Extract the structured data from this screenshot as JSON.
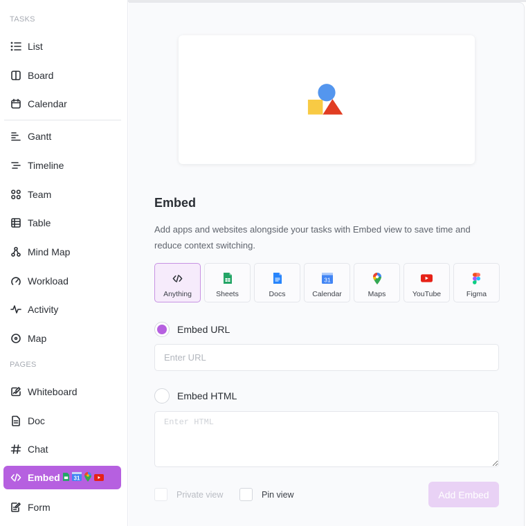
{
  "sidebar": {
    "sections": {
      "tasks": "TASKS",
      "pages": "PAGES"
    },
    "task_items": [
      {
        "label": "List",
        "icon": "list-icon"
      },
      {
        "label": "Board",
        "icon": "board-icon"
      },
      {
        "label": "Calendar",
        "icon": "calendar-icon"
      },
      {
        "label": "Gantt",
        "icon": "gantt-icon"
      },
      {
        "label": "Timeline",
        "icon": "timeline-icon"
      },
      {
        "label": "Team",
        "icon": "team-icon"
      },
      {
        "label": "Table",
        "icon": "table-icon"
      },
      {
        "label": "Mind Map",
        "icon": "mind-map-icon"
      },
      {
        "label": "Workload",
        "icon": "workload-icon"
      },
      {
        "label": "Activity",
        "icon": "activity-icon"
      },
      {
        "label": "Map",
        "icon": "map-pin-icon"
      }
    ],
    "page_items": [
      {
        "label": "Whiteboard",
        "icon": "whiteboard-icon"
      },
      {
        "label": "Doc",
        "icon": "doc-icon"
      },
      {
        "label": "Chat",
        "icon": "hash-icon"
      },
      {
        "label": "Embed",
        "icon": "code-icon",
        "active": true
      },
      {
        "label": "Form",
        "icon": "form-icon"
      }
    ]
  },
  "main": {
    "title": "Embed",
    "description": "Add apps and websites alongside your tasks with Embed view to save time and reduce context switching.",
    "tiles": [
      {
        "label": "Anything",
        "icon": "code-icon",
        "selected": true
      },
      {
        "label": "Sheets",
        "icon": "google-sheets-icon"
      },
      {
        "label": "Docs",
        "icon": "google-docs-icon"
      },
      {
        "label": "Calendar",
        "icon": "google-calendar-icon",
        "icon_text": "31"
      },
      {
        "label": "Maps",
        "icon": "google-maps-icon"
      },
      {
        "label": "YouTube",
        "icon": "youtube-icon"
      },
      {
        "label": "Figma",
        "icon": "figma-icon"
      }
    ],
    "embed_url": {
      "label": "Embed URL",
      "selected": true,
      "placeholder": "Enter URL",
      "value": ""
    },
    "embed_html": {
      "label": "Embed HTML",
      "selected": false,
      "placeholder": "Enter HTML",
      "value": ""
    },
    "private_view": {
      "label": "Private view",
      "checked": false,
      "disabled": true
    },
    "pin_view": {
      "label": "Pin view",
      "checked": false
    },
    "add_button": "Add Embed"
  },
  "colors": {
    "accent": "#b660e0",
    "accent_light": "#e9d2f5",
    "illustration_blue": "#5496ee",
    "illustration_yellow": "#f8ca44",
    "illustration_red": "#e13d22"
  }
}
